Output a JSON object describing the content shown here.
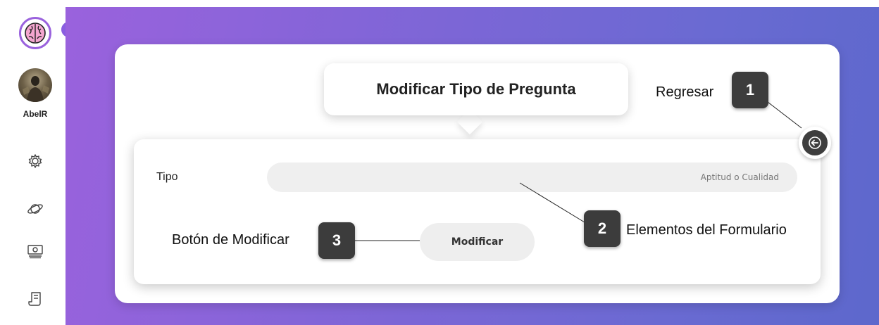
{
  "sidebar": {
    "username": "AbelR",
    "nav_items": [
      {
        "icon": "gear-icon"
      },
      {
        "icon": "planet-icon"
      },
      {
        "icon": "money-icon"
      },
      {
        "icon": "document-icon"
      }
    ]
  },
  "header": {
    "title": "Modificar Tipo de Pregunta"
  },
  "form": {
    "tipo_label": "Tipo",
    "tipo_placeholder": "Aptitud o Cualidad",
    "submit_label": "Modificar"
  },
  "annotations": [
    {
      "number": "1",
      "label": "Regresar"
    },
    {
      "number": "2",
      "label": "Elementos del Formulario"
    },
    {
      "number": "3",
      "label": "Botón de Modificar"
    }
  ],
  "colors": {
    "accent": "#8a5ee0",
    "gradient_start": "#9a62dd",
    "gradient_end": "#5d68cc",
    "badge": "#3c3c3c"
  }
}
